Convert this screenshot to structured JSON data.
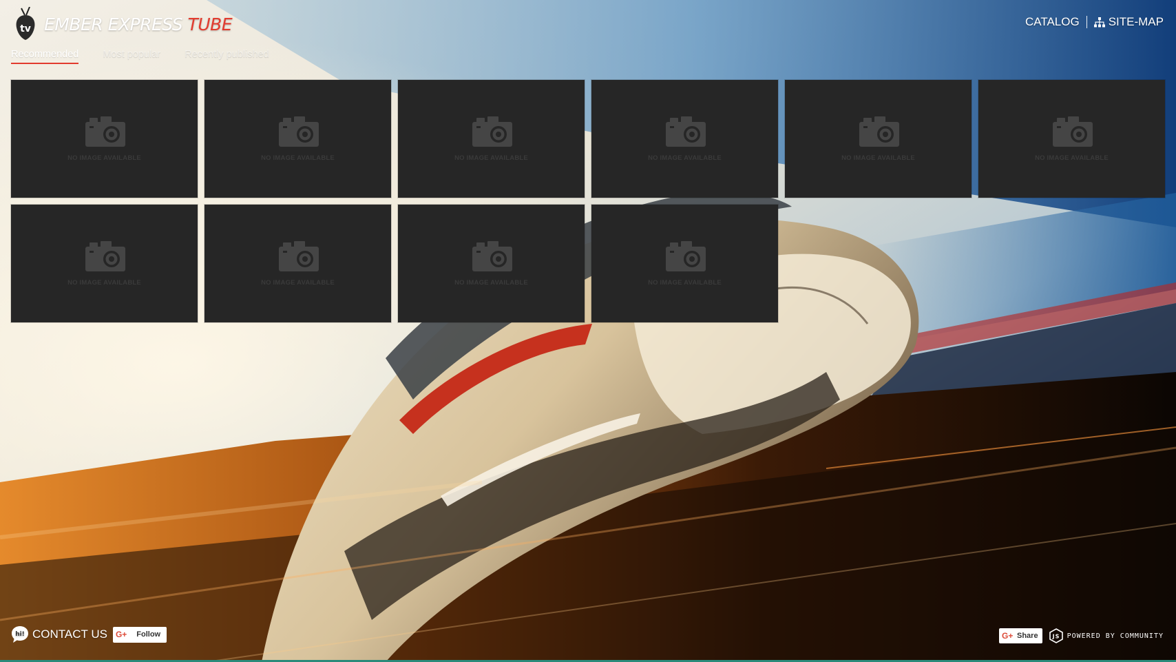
{
  "brand": {
    "title_main": "EMBER EXPRESS ",
    "title_accent": "TUBE",
    "logo_icon_text": "tv",
    "accent_color": "#e23b2e"
  },
  "nav": {
    "catalog_label": "CATALOG",
    "sitemap_label": "SITE-MAP",
    "sitemap_icon": "sitemap-icon"
  },
  "tabs": [
    {
      "label": "Recommended",
      "active": true
    },
    {
      "label": "Most popular",
      "active": false
    },
    {
      "label": "Recently published",
      "active": false
    }
  ],
  "thumbnails": {
    "placeholder_icon": "camera-icon",
    "items": [
      {
        "label": "NO IMAGE AVAILABLE"
      },
      {
        "label": "NO IMAGE AVAILABLE"
      },
      {
        "label": "NO IMAGE AVAILABLE"
      },
      {
        "label": "NO IMAGE AVAILABLE"
      },
      {
        "label": "NO IMAGE AVAILABLE"
      },
      {
        "label": "NO IMAGE AVAILABLE"
      },
      {
        "label": "NO IMAGE AVAILABLE"
      },
      {
        "label": "NO IMAGE AVAILABLE"
      },
      {
        "label": "NO IMAGE AVAILABLE"
      },
      {
        "label": "NO IMAGE AVAILABLE"
      }
    ]
  },
  "footer": {
    "contact_label": "CONTACT US",
    "contact_icon_text": "hi!",
    "follow_label": "Follow",
    "share_label": "Share",
    "gplus_icon_text": "G+",
    "powered_label": "POWERED BY COMMUNITY"
  }
}
